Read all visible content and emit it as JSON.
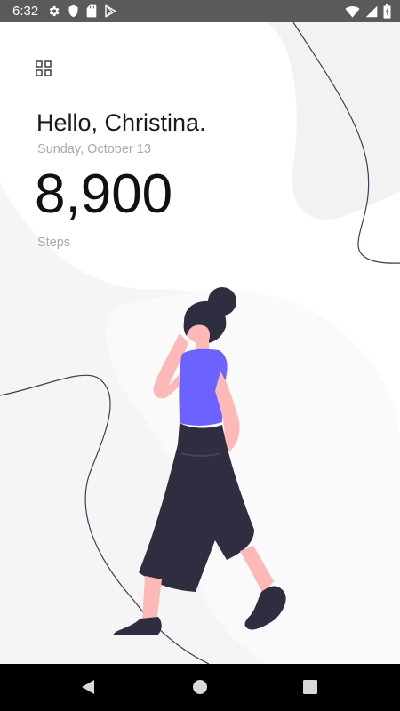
{
  "status_bar": {
    "time": "6:32",
    "left_icons": [
      "gear-icon",
      "shield-icon",
      "sd-card-icon",
      "play-store-icon"
    ],
    "right_icons": [
      "wifi-icon",
      "cellular-signal-icon",
      "battery-charging-icon"
    ]
  },
  "home": {
    "menu_icon": "grid-icon",
    "greeting": "Hello, Christina.",
    "date": "Sunday, October 13",
    "step_count": "8,900",
    "step_label": "Steps"
  },
  "colors": {
    "accent_purple": "#6c63ff",
    "clothing_dark": "#2f2e41",
    "skin": "#ffb8b8",
    "background_shape": "#f2f2f2"
  },
  "nav_bar": {
    "buttons": [
      "back-icon",
      "home-icon",
      "recents-icon"
    ]
  }
}
